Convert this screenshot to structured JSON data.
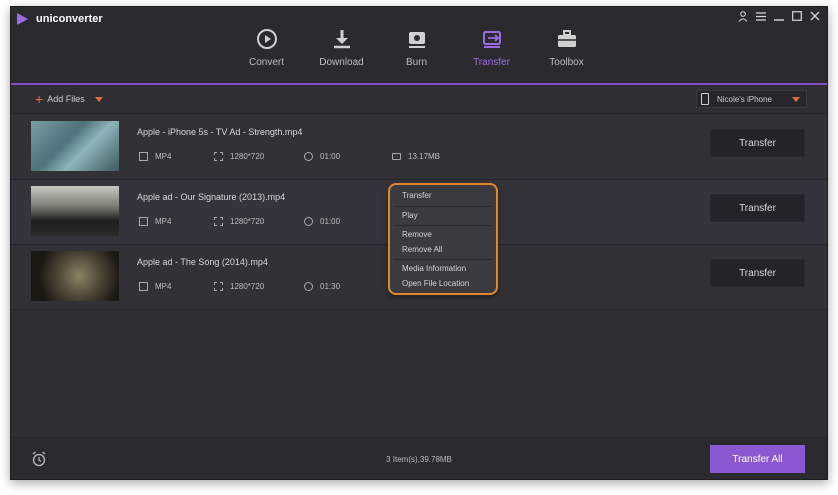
{
  "app": {
    "name": "uniconverter"
  },
  "nav": {
    "tabs": [
      {
        "label": "Convert",
        "icon": "convert-icon"
      },
      {
        "label": "Download",
        "icon": "download-icon"
      },
      {
        "label": "Burn",
        "icon": "burn-icon"
      },
      {
        "label": "Transfer",
        "icon": "transfer-icon",
        "active": true
      },
      {
        "label": "Toolbox",
        "icon": "toolbox-icon"
      }
    ]
  },
  "toolbar": {
    "add_files": "Add Files",
    "device": "Nicole's iPhone"
  },
  "files": [
    {
      "name": "Apple - iPhone 5s - TV Ad - Strength.mp4",
      "format": "MP4",
      "resolution": "1280*720",
      "duration": "01:00",
      "size": "13.17MB"
    },
    {
      "name": "Apple ad - Our Signature (2013).mp4",
      "format": "MP4",
      "resolution": "1280*720",
      "duration": "01:00",
      "size": ""
    },
    {
      "name": "Apple ad - The Song (2014).mp4",
      "format": "MP4",
      "resolution": "1280*720",
      "duration": "01:30",
      "size": ""
    }
  ],
  "row_action": "Transfer",
  "context_menu": {
    "items": [
      "Transfer",
      "Play",
      "Remove",
      "Remove All",
      "Media Information",
      "Open File Location"
    ]
  },
  "footer": {
    "count": "3 Item(s),39.78MB",
    "transfer_all": "Transfer All"
  },
  "colors": {
    "accent": "#8a58d0",
    "highlight": "#e2862f",
    "add": "#e36a3a"
  }
}
